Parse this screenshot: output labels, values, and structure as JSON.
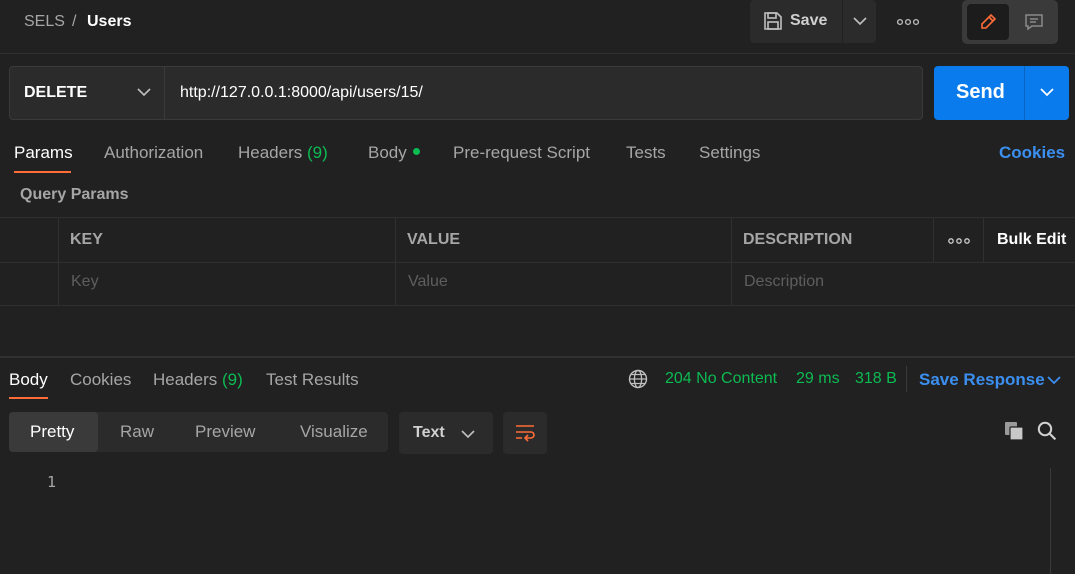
{
  "header": {
    "breadcrumb_parent": "SELS",
    "breadcrumb_separator": "/",
    "breadcrumb_current": "Users",
    "save_label": "Save",
    "save_icon": "floppy-disk-icon",
    "more_icon": "ellipsis-icon",
    "mode_icons": [
      "pencil-icon",
      "comment-icon"
    ]
  },
  "request": {
    "method": "DELETE",
    "url": "http://127.0.0.1:8000/api/users/15/",
    "send_label": "Send"
  },
  "request_tabs": {
    "params": "Params",
    "authorization": "Authorization",
    "headers": "Headers",
    "headers_count": "(9)",
    "body": "Body",
    "pre_request": "Pre-request Script",
    "tests": "Tests",
    "settings": "Settings",
    "cookies": "Cookies"
  },
  "params": {
    "title": "Query Params",
    "columns": [
      "KEY",
      "VALUE",
      "DESCRIPTION"
    ],
    "bulk_edit": "Bulk Edit",
    "placeholders": [
      "Key",
      "Value",
      "Description"
    ]
  },
  "response": {
    "tabs": {
      "body": "Body",
      "cookies": "Cookies",
      "headers": "Headers",
      "headers_count": "(9)",
      "test_results": "Test Results"
    },
    "status": "204 No Content",
    "time": "29 ms",
    "size": "318 B",
    "save_response": "Save Response",
    "views": [
      "Pretty",
      "Raw",
      "Preview",
      "Visualize"
    ],
    "format": "Text",
    "line_numbers": [
      "1"
    ]
  },
  "colors": {
    "accent_orange": "#ff6c37",
    "send_blue": "#097bed",
    "success_green": "#0cbb52",
    "link_blue": "#3b8ff0"
  }
}
